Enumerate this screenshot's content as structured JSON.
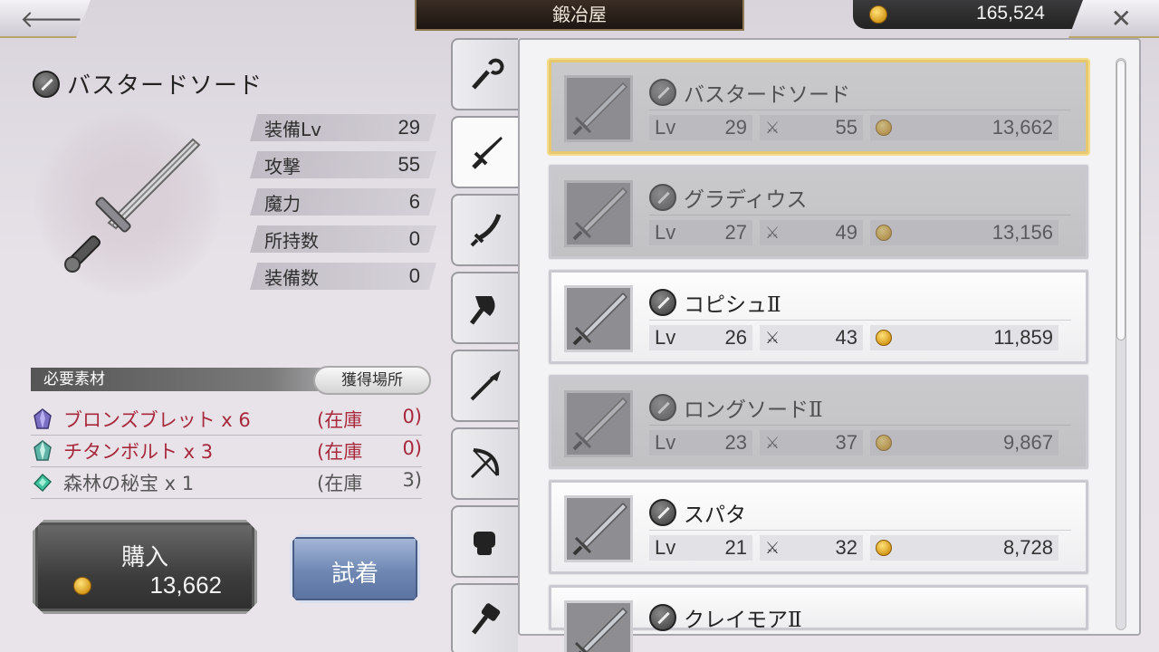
{
  "header": {
    "back_icon": "left-arrow-icon",
    "title": "鍛冶屋",
    "gold": "165,524",
    "close_icon": "close-icon"
  },
  "detail": {
    "name": "バスタードソード",
    "stats": [
      {
        "label": "装備Lv",
        "value": "29"
      },
      {
        "label": "攻撃",
        "value": "55"
      },
      {
        "label": "魔力",
        "value": "6"
      },
      {
        "label": "所持数",
        "value": "0"
      },
      {
        "label": "装備数",
        "value": "0"
      }
    ],
    "materials_header": "必要素材",
    "acquire_button": "獲得場所",
    "materials": [
      {
        "name": "ブロンズブレット x 6",
        "stock_label": "(在庫",
        "stock": "0)",
        "color": "#a8283c"
      },
      {
        "name": "チタンボルト x 3",
        "stock_label": "(在庫",
        "stock": "0)",
        "color": "#a8283c"
      },
      {
        "name": "森林の秘宝 x 1",
        "stock_label": "(在庫",
        "stock": "3)",
        "color": "#555555"
      }
    ],
    "buy_label": "購入",
    "buy_price": "13,662",
    "try_label": "試着"
  },
  "tabs": [
    "staff-icon",
    "sword-icon",
    "katana-icon",
    "axe-icon",
    "spear-icon",
    "bow-icon",
    "fist-icon",
    "hammer-icon"
  ],
  "items": [
    {
      "name": "バスタードソード",
      "lv_label": "Lv",
      "lv": "29",
      "atk": "55",
      "price": "13,662",
      "selected": true,
      "dim": true
    },
    {
      "name": "グラディウス",
      "lv_label": "Lv",
      "lv": "27",
      "atk": "49",
      "price": "13,156",
      "selected": false,
      "dim": true
    },
    {
      "name": "コピシュⅡ",
      "lv_label": "Lv",
      "lv": "26",
      "atk": "43",
      "price": "11,859",
      "selected": false,
      "dim": false
    },
    {
      "name": "ロングソードⅡ",
      "lv_label": "Lv",
      "lv": "23",
      "atk": "37",
      "price": "9,867",
      "selected": false,
      "dim": true
    },
    {
      "name": "スパタ",
      "lv_label": "Lv",
      "lv": "21",
      "atk": "32",
      "price": "8,728",
      "selected": false,
      "dim": false
    },
    {
      "name": "クレイモアⅡ",
      "lv_label": "",
      "lv": "",
      "atk": "",
      "price": "",
      "selected": false,
      "dim": false
    }
  ]
}
